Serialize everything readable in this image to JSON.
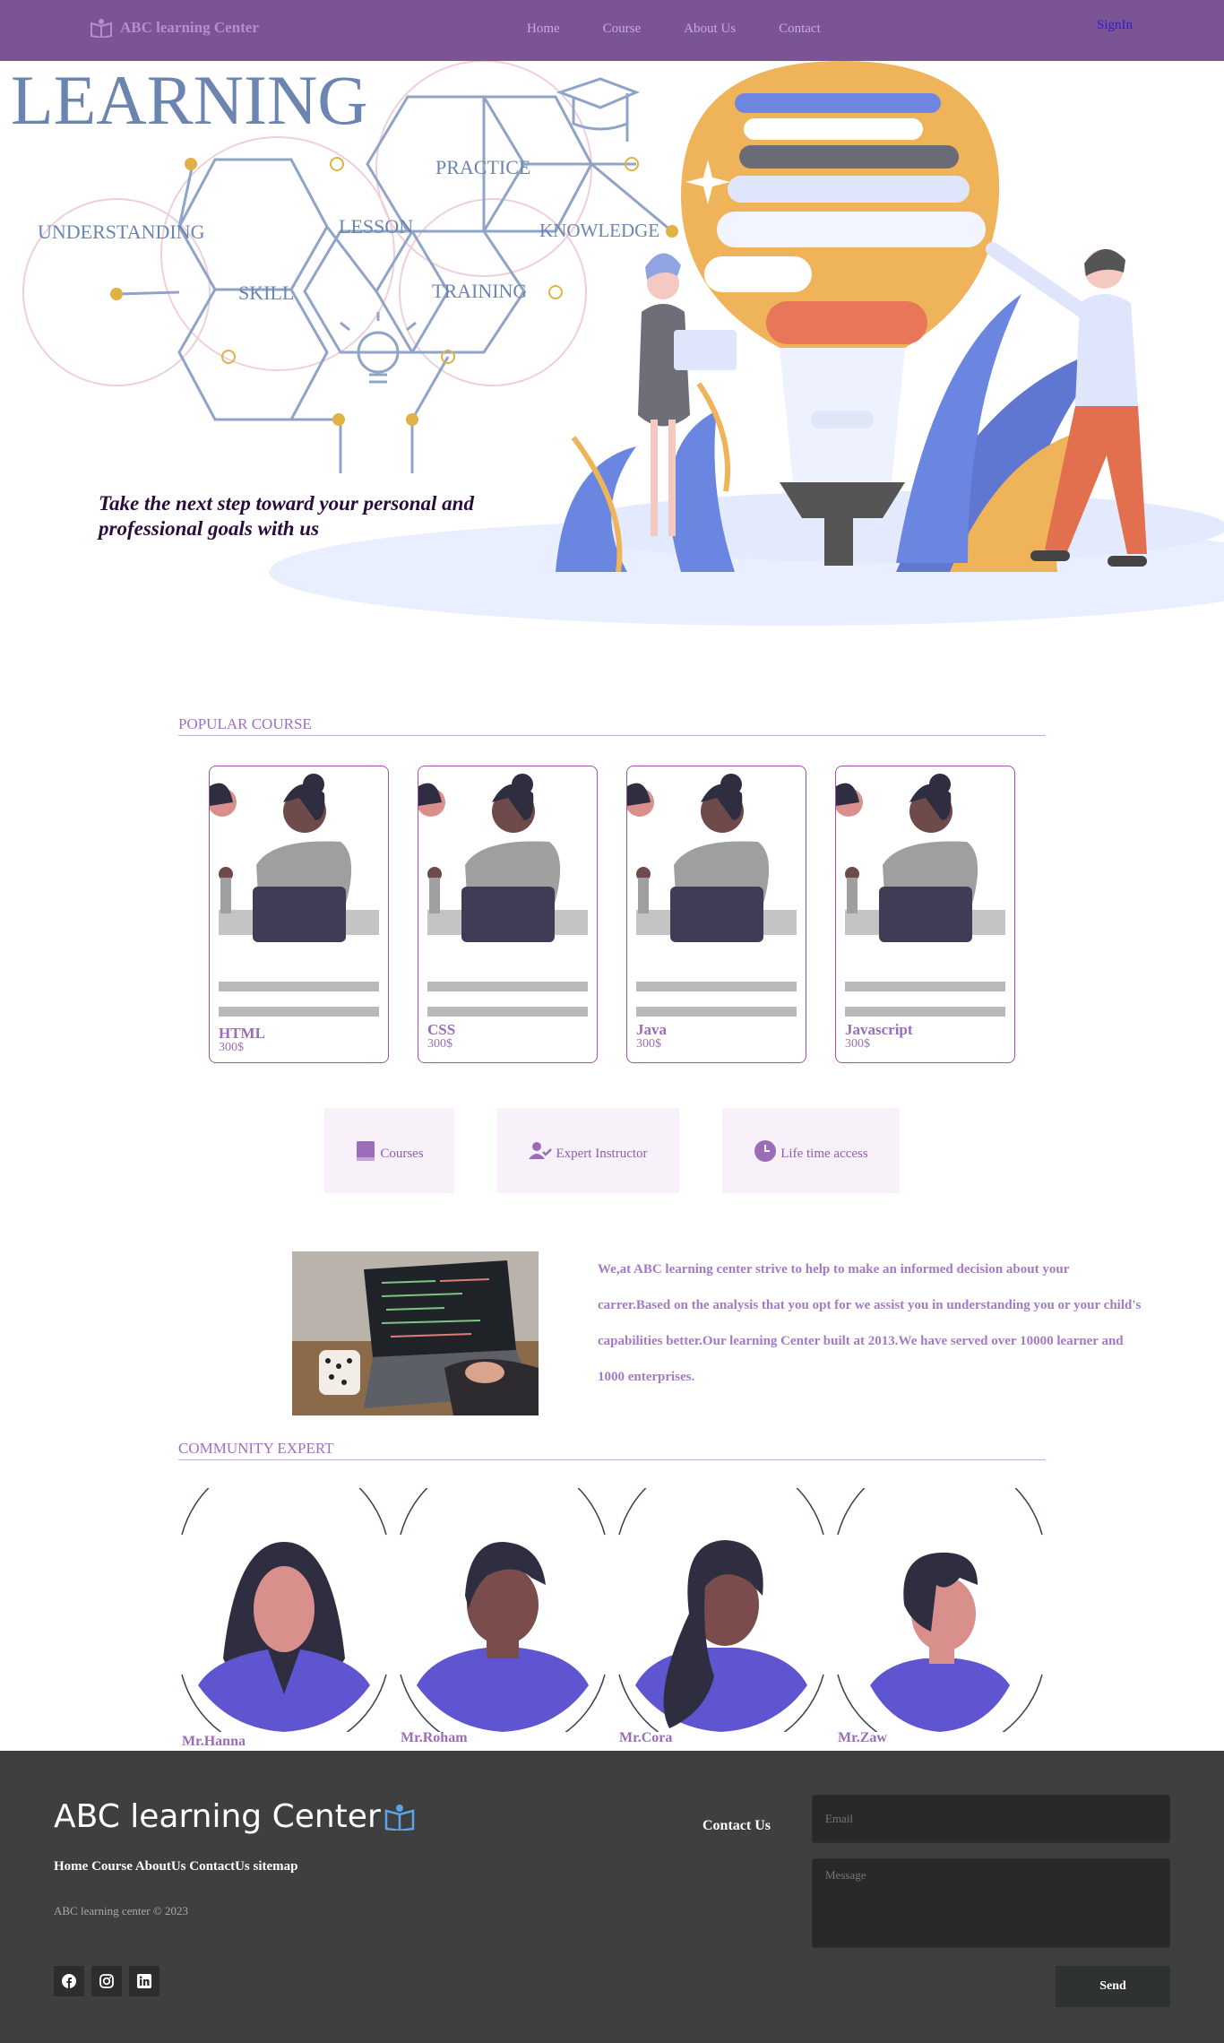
{
  "nav": {
    "brand": "ABC learning Center",
    "links": [
      "Home",
      "Course",
      "About Us",
      "Contact"
    ],
    "signin": "SignIn"
  },
  "hero": {
    "heading": "LEARNING",
    "words": [
      "UNDERSTANDING",
      "PRACTICE",
      "LESSON",
      "KNOWLEDGE",
      "SKILL",
      "TRAINING"
    ],
    "tagline": "Take the next step toward your personal and professional goals with us"
  },
  "popular": {
    "title": "POPULAR COURSE",
    "courses": [
      {
        "name": "HTML",
        "price": "300$"
      },
      {
        "name": "CSS",
        "price": "300$"
      },
      {
        "name": "Java",
        "price": "300$"
      },
      {
        "name": "Javascript",
        "price": "300$"
      }
    ]
  },
  "features": [
    {
      "label": "Courses",
      "icon": "book-icon"
    },
    {
      "label": "Expert Instructor",
      "icon": "user-check-icon"
    },
    {
      "label": "Life time access",
      "icon": "clock-icon"
    }
  ],
  "about": {
    "text": "We,at ABC learning center strive to help to make an informed decision about your carrer.Based on the analysis that you opt for we assist you in understanding you or your child's capabilities better.Our learning Center built at 2013.We have served over 10000 learner and 1000 enterprises."
  },
  "community": {
    "title": "COMMUNITY EXPERT",
    "experts": [
      "Mr.Hanna",
      "Mr.Roham",
      "Mr.Cora",
      "Mr.Zaw"
    ]
  },
  "footer": {
    "brand": "ABC learning Center",
    "links": "Home Course AboutUs ContactUs sitemap",
    "copyright": "ABC learning center © 2023",
    "contact_label": "Contact Us",
    "email_placeholder": "Email",
    "message_placeholder": "Message",
    "send_label": "Send"
  },
  "colors": {
    "nav": "#7a5494",
    "accent": "#9b6db8",
    "footer": "#3f3f40"
  }
}
